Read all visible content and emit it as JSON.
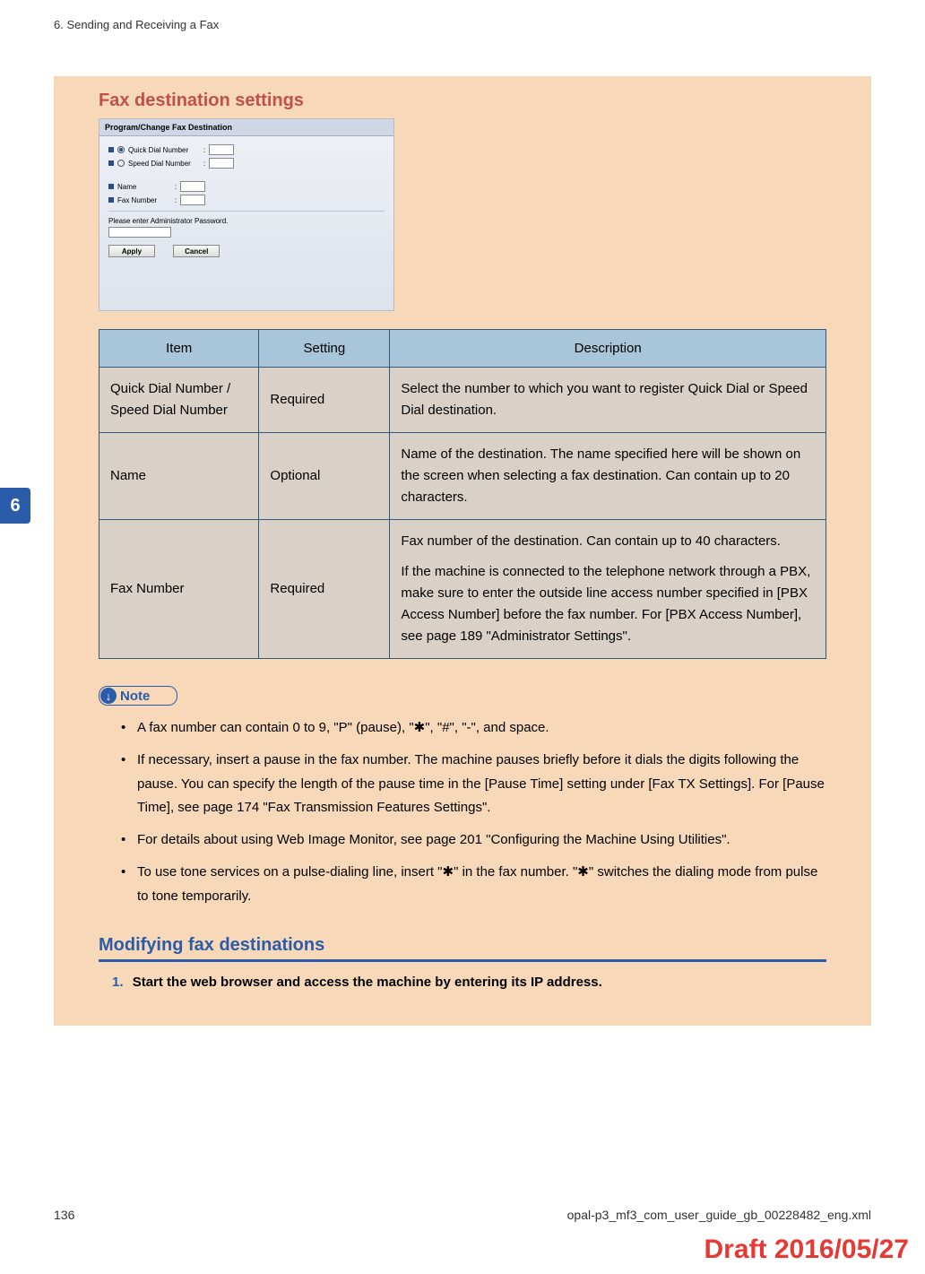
{
  "running_head": "6. Sending and Receiving a Fax",
  "side_tab": "6",
  "section_title": "Fax destination settings",
  "screenshot": {
    "title": "Program/Change Fax Destination",
    "radio1": "Quick Dial Number",
    "radio2": "Speed Dial Number",
    "name_label": "Name",
    "fax_label": "Fax Number",
    "pw_label": "Please enter Administrator Password.",
    "apply": "Apply",
    "cancel": "Cancel"
  },
  "table": {
    "headers": {
      "item": "Item",
      "setting": "Setting",
      "description": "Description"
    },
    "rows": [
      {
        "item": "Quick Dial Number / Speed Dial Number",
        "setting": "Required",
        "desc": [
          "Select the number to which you want to register Quick Dial or Speed Dial destination."
        ]
      },
      {
        "item": "Name",
        "setting": "Optional",
        "desc": [
          "Name of the destination. The name specified here will be shown on the screen when selecting a fax destination. Can contain up to 20 characters."
        ]
      },
      {
        "item": "Fax Number",
        "setting": "Required",
        "desc": [
          "Fax number of the destination. Can contain up to 40 characters.",
          "If the machine is connected to the telephone network through a PBX, make sure to enter the outside line access number specified in [PBX Access Number] before the fax number. For [PBX Access Number], see page 189 \"Administrator Settings\"."
        ]
      }
    ]
  },
  "note_label": "Note",
  "notes": [
    "A fax number can contain 0 to 9, \"P\" (pause), \"✱\", \"#\", \"-\", and space.",
    "If necessary, insert a pause in the fax number. The machine pauses briefly before it dials the digits following the pause. You can specify the length of the pause time in the [Pause Time] setting under [Fax TX Settings]. For [Pause Time], see page 174 \"Fax Transmission Features Settings\".",
    "For details about using Web Image Monitor, see page 201 \"Configuring the Machine Using Utilities\".",
    "To use tone services on a pulse-dialing line, insert \"✱\" in the fax number. \"✱\" switches the dialing mode from pulse to tone temporarily."
  ],
  "subsection_title": "Modifying fax destinations",
  "step1": {
    "num": "1.",
    "text": "Start the web browser and access the machine by entering its IP address."
  },
  "footer": {
    "page": "136",
    "path": "opal-p3_mf3_com_user_guide_gb_00228482_eng.xml"
  },
  "draft": "Draft 2016/05/27"
}
